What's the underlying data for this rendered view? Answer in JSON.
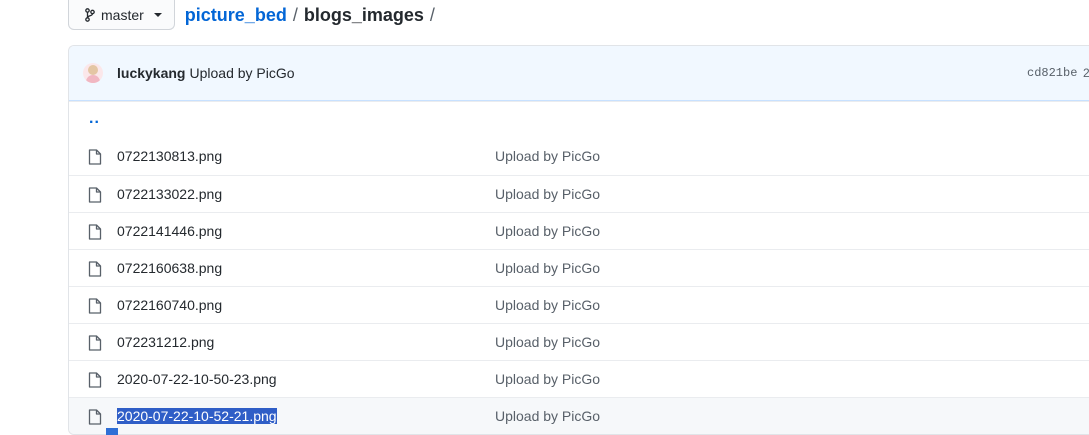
{
  "branch": {
    "label": "master"
  },
  "breadcrumb": {
    "repo": "picture_bed",
    "separator": "/",
    "folder": "blogs_images",
    "trailing": "/"
  },
  "commit": {
    "author": "luckykang",
    "message": "Upload by PicGo",
    "sha": "cd821be",
    "sha_tail": "2"
  },
  "up_dir": {
    "label": ".."
  },
  "files": [
    {
      "name": "0722130813.png",
      "message": "Upload by PicGo"
    },
    {
      "name": "0722133022.png",
      "message": "Upload by PicGo"
    },
    {
      "name": "0722141446.png",
      "message": "Upload by PicGo"
    },
    {
      "name": "0722160638.png",
      "message": "Upload by PicGo"
    },
    {
      "name": "0722160740.png",
      "message": "Upload by PicGo"
    },
    {
      "name": "072231212.png",
      "message": "Upload by PicGo"
    },
    {
      "name": "2020-07-22-10-50-23.png",
      "message": "Upload by PicGo"
    },
    {
      "name": "2020-07-22-10-52-21.png",
      "message": "Upload by PicGo",
      "selected": true
    }
  ],
  "colors": {
    "link": "#0366d6",
    "selection": "#2f5ec7",
    "commit_bg": "#f1f8ff"
  },
  "icons": {
    "branch": "git-branch-icon",
    "file": "file-icon",
    "caret": "chevron-down-icon"
  }
}
